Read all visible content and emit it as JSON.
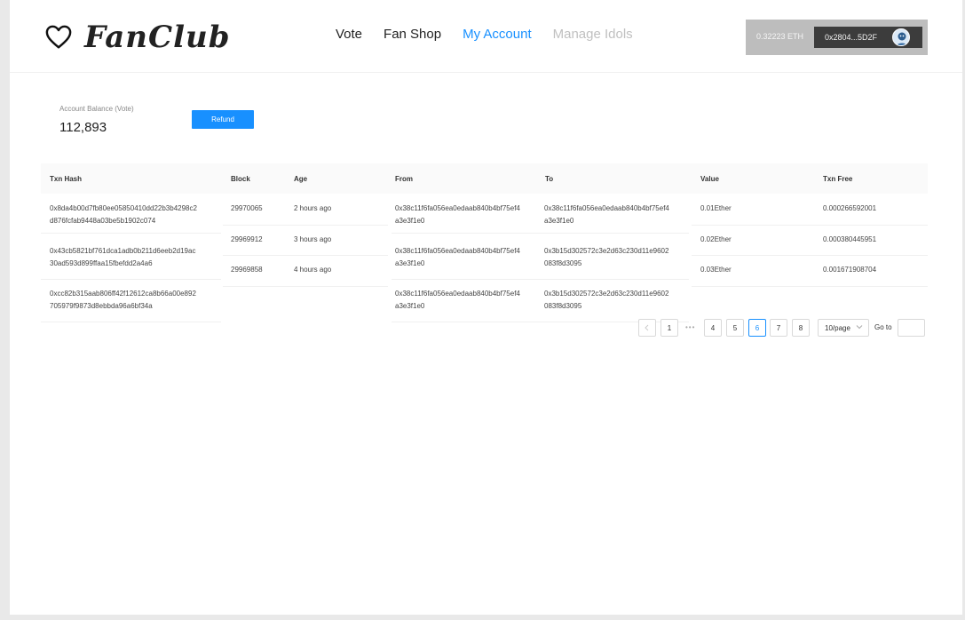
{
  "brand": {
    "name": "FanClub"
  },
  "nav": [
    {
      "label": "Vote",
      "state": "normal"
    },
    {
      "label": "Fan Shop",
      "state": "normal"
    },
    {
      "label": "My Account",
      "state": "active"
    },
    {
      "label": "Manage Idols",
      "state": "disabled"
    }
  ],
  "wallet": {
    "balance": "0.32223 ETH",
    "address": "0x2804...5D2F"
  },
  "account": {
    "balance_label": "Account Balance (Vote)",
    "balance_value": "112,893",
    "refund_label": "Refund"
  },
  "table": {
    "headers": [
      "Txn Hash",
      "Block",
      "Age",
      "From",
      "To",
      "Value",
      "Txn Free"
    ],
    "hash_col": [
      [
        "0x8da4b00d7fb80ee05850410dd22b3b4298c2",
        "d876fcfab9448a03be5b1902c074"
      ],
      [
        "0x43cb5821bf761dca1adb0b211d6eeb2d19ac",
        "30ad593d899ffaa15fbefdd2a4a6"
      ],
      [
        "0xcc82b315aab806ff42f12612ca8b66a00e892",
        "705979f9873d8ebbda96a6bf34a"
      ]
    ],
    "block_col": [
      "29970065",
      "29969912",
      "29969858"
    ],
    "age_col": [
      "2 hours ago",
      "3 hours ago",
      "4 hours ago"
    ],
    "from_col": [
      [
        "0x38c11f6fa056ea0edaab840b4bf75ef4",
        "a3e3f1e0"
      ],
      [
        "0x38c11f6fa056ea0edaab840b4bf75ef4",
        "a3e3f1e0"
      ],
      [
        "0x38c11f6fa056ea0edaab840b4bf75ef4",
        "a3e3f1e0"
      ]
    ],
    "to_col": [
      [
        "0x38c11f6fa056ea0edaab840b4bf75ef4",
        "a3e3f1e0"
      ],
      [
        "0x3b15d302572c3e2d63c230d11e9602",
        "083f8d3095"
      ],
      [
        "0x3b15d302572c3e2d63c230d11e9602",
        "083f8d3095"
      ]
    ],
    "value_col": [
      "0.01Ether",
      "0.02Ether",
      "0.03Ether"
    ],
    "fee_col": [
      "0.000266592001",
      "0.000380445951",
      "0.001671908704"
    ]
  },
  "pagination": {
    "prev_icon": "chevron-left-icon",
    "pages": [
      "1",
      "4",
      "5",
      "6",
      "7",
      "8"
    ],
    "current": "6",
    "ellipsis": "•••",
    "page_size": "10/page",
    "goto_label": "Go to",
    "goto_value": ""
  },
  "colors": {
    "accent": "#1890ff",
    "wallet_bg": "#bdbdbd",
    "address_bg": "#3c3c3c"
  }
}
